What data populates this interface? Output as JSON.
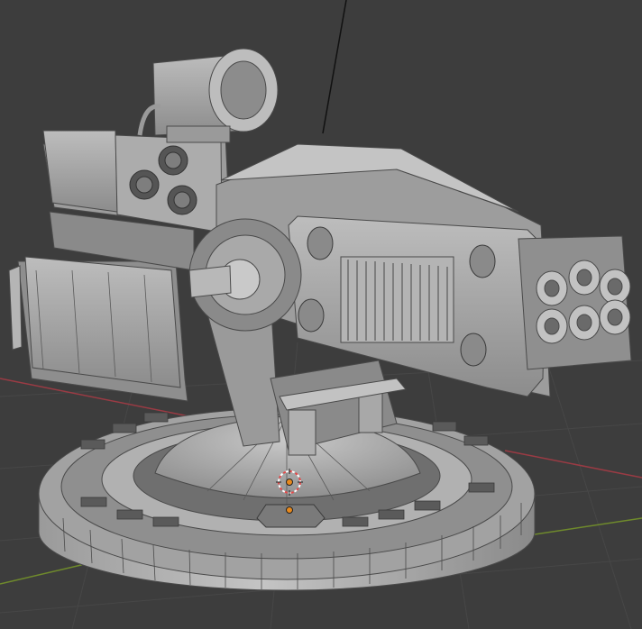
{
  "viewport": {
    "background": "#3d3d3d",
    "grid_color": "#474747",
    "x_axis_color": "#9a3b44",
    "y_axis_color": "#6f8a2c",
    "mesh_fill": "#a6a6a6",
    "mesh_shadow": "#777777",
    "mesh_highlight": "#cfcfcf",
    "wire_color": "#4a4a4a",
    "origin_color": "#e8891c",
    "cursor_color": "#e34a4a"
  },
  "model": {
    "object": "turret",
    "parts": [
      "base-ring",
      "dome",
      "pivot-mount",
      "gatling-barrel-housing",
      "rocket-pod",
      "side-shield",
      "scope",
      "antenna"
    ]
  }
}
